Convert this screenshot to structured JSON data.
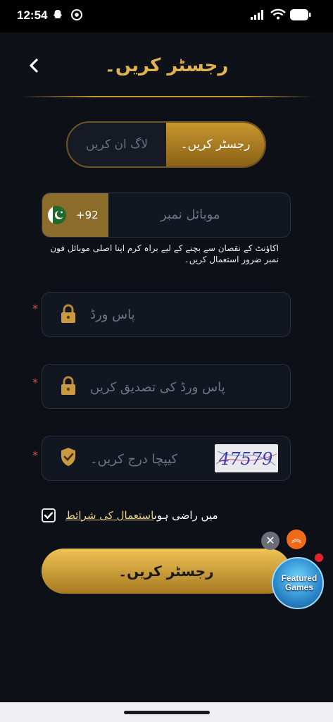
{
  "status_bar": {
    "time": "12:54"
  },
  "header": {
    "title": "رجسٹر کریں۔"
  },
  "tabs": {
    "login": "لاگ ان کریں",
    "register": "رجسٹر کریں۔"
  },
  "phone": {
    "country_code": "+92",
    "placeholder": "موبائل نمبر"
  },
  "hint": "اکاؤنٹ کے نقصان سے بچنے کے لیے براہ کرم اپنا اصلی موبائل فون نمبر ضرور استعمال کریں۔",
  "password": {
    "placeholder": "پاس ورڈ"
  },
  "confirm_password": {
    "placeholder": "پاس ورڈ کی تصدیق کریں"
  },
  "captcha": {
    "placeholder": "کیپچا درج کریں۔",
    "code": "47579"
  },
  "agreement": {
    "prefix": "میں راضی ہوں",
    "link": "استعمال کی شرائط",
    "checked": true
  },
  "submit": {
    "label": "رجسٹر کریں۔"
  },
  "floating": {
    "badge_text_1": "Featured",
    "badge_text_2": "Games"
  },
  "colors": {
    "accent": "#e1b24e",
    "background": "#0e1018",
    "button": "#d9a842",
    "required": "#e04848"
  }
}
